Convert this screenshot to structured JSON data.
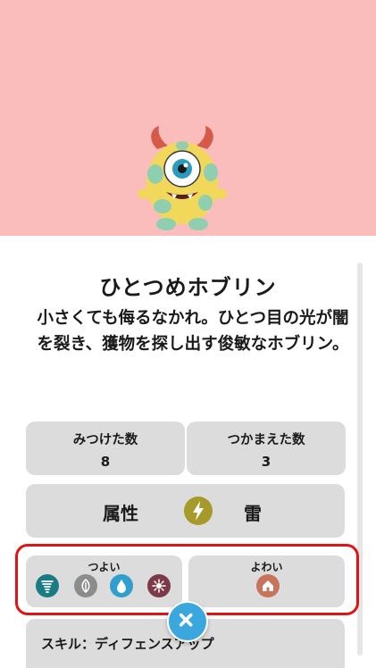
{
  "colors": {
    "hero_bg": "#fbbcbc",
    "card_bg": "#dcdcdc",
    "accent_blue": "#3aa7df",
    "highlight_red": "#e01414",
    "thunder_icon": "#a59a2a"
  },
  "monster": {
    "image": "one-eyed-horned-monster",
    "name": "ひとつめホブリン",
    "description": "小さくても侮るなかれ。ひとつ目の光が闇を裂き、獲物を探し出す俊敏なホブリン。"
  },
  "stats": {
    "found": {
      "label": "みつけた数",
      "value": "8"
    },
    "caught": {
      "label": "つかまえた数",
      "value": "3"
    }
  },
  "attribute": {
    "label": "属性",
    "icon": "lightning-icon",
    "value": "雷"
  },
  "strong": {
    "label": "つよい",
    "icons": [
      "tornado-icon",
      "leaf-icon",
      "water-drop-icon",
      "spark-icon"
    ],
    "icon_colors": [
      "#1b7b84",
      "#8c8c8c",
      "#2f9fcf",
      "#7b3a4a"
    ]
  },
  "weak": {
    "label": "よわい",
    "icons": [
      "house-icon"
    ],
    "icon_colors": [
      "#c8745a"
    ]
  },
  "skill": {
    "text": "スキル：ディフェンスアップ"
  },
  "close_icon": "close-icon"
}
